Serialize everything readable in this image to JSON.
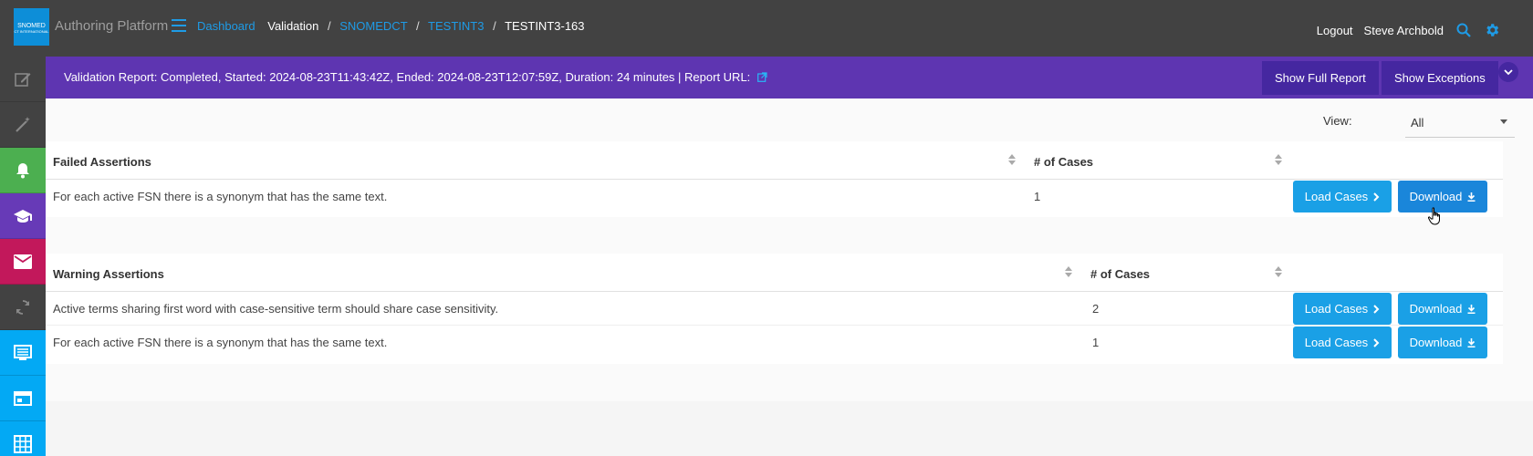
{
  "header": {
    "logo_text": "SNOMED",
    "logo_sub": "CT INTERNATIONAL",
    "app_title": "Authoring Platform",
    "breadcrumbs": {
      "dashboard": "Dashboard",
      "validation": "Validation",
      "edition": "SNOMEDCT",
      "project": "TESTINT3",
      "task": "TESTINT3-163"
    },
    "logout": "Logout",
    "user": "Steve Archbold"
  },
  "banner": {
    "text": "Validation Report: Completed, Started: 2024-08-23T11:43:42Z, Ended: 2024-08-23T12:07:59Z, Duration: 24 minutes | Report URL:",
    "show_full_report": "Show Full Report",
    "show_exceptions": "Show Exceptions"
  },
  "view": {
    "label": "View:",
    "selected": "All"
  },
  "failed_table": {
    "col1": "Failed Assertions",
    "col2": "# of Cases",
    "rows": [
      {
        "assertion": "For each active FSN there is a synonym that has the same text.",
        "cases": "1"
      }
    ]
  },
  "warning_table": {
    "col1": "Warning Assertions",
    "col2": "# of Cases",
    "rows": [
      {
        "assertion": "Active terms sharing first word with case-sensitive term should share case sensitivity.",
        "cases": "2"
      },
      {
        "assertion": "For each active FSN there is a synonym that has the same text.",
        "cases": "1"
      }
    ]
  },
  "buttons": {
    "load_cases": "Load Cases",
    "download": "Download"
  },
  "colors": {
    "topbar": "#424242",
    "banner": "#5e35b1",
    "accent": "#1e9be6",
    "sidebar_green": "#4caf50",
    "sidebar_purple": "#673ab7",
    "sidebar_pink": "#c2185b",
    "sidebar_blue": "#03a9f4"
  }
}
